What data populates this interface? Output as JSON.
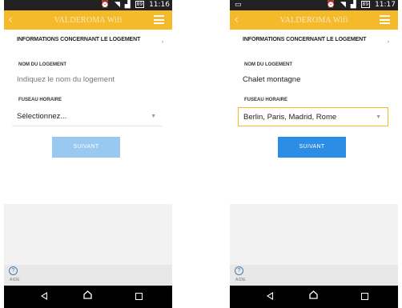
{
  "screens": {
    "left": {
      "status": {
        "time": "11:16",
        "battery": "89"
      },
      "header": {
        "title": "VALDEROMA Wifi"
      },
      "section_title": "INFORMATIONS CONCERNANT LE LOGEMENT",
      "name_label": "NOM DU LOGEMENT",
      "name_placeholder": "Indiquez le nom du logement",
      "timezone_label": "FUSEAU HORAIRE",
      "timezone_value": "Sélectionnez...",
      "next_label": "SUIVANT",
      "help_label": "AIDE"
    },
    "right": {
      "status": {
        "time": "11:17",
        "battery": "89"
      },
      "header": {
        "title": "VALDEROMA Wifi"
      },
      "section_title": "INFORMATIONS CONCERNANT LE LOGEMENT",
      "name_label": "NOM DU LOGEMENT",
      "name_value": "Chalet montagne",
      "timezone_label": "FUSEAU HORAIRE",
      "timezone_value": "Berlin, Paris, Madrid, Rome",
      "next_label": "SUIVANT",
      "help_label": "AIDE"
    }
  },
  "colors": {
    "header": "#f4ba2a",
    "button_disabled": "#99c8f0",
    "button_enabled": "#2d8de4"
  }
}
